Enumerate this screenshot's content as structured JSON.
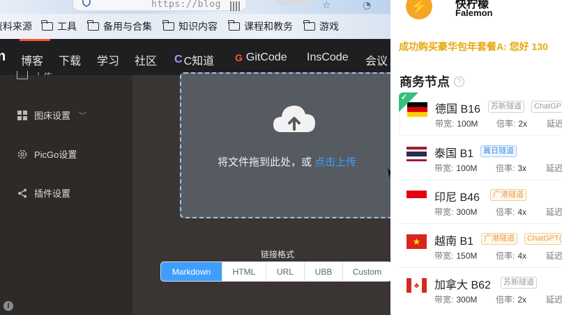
{
  "browser": {
    "url_partial": "https://blog",
    "bookmarks": [
      "资料来源",
      "工具",
      "备用与合集",
      "知识内容",
      "课程和教务",
      "游戏"
    ]
  },
  "nav": {
    "logo_fragment": "n",
    "items": [
      "博客",
      "下载",
      "学习",
      "社区",
      "C知道",
      "GitCode",
      "InsCode",
      "会议"
    ],
    "badges": {
      "cknow": "C",
      "gitcode": "G"
    },
    "accent_color": "#fc5531"
  },
  "sidebar": {
    "items": [
      {
        "label": "图床设置",
        "icon": "grid-icon"
      },
      {
        "label": "PicGo设置",
        "icon": "gear-icon"
      },
      {
        "label": "插件设置",
        "icon": "share-icon"
      }
    ],
    "partial_label": "上传"
  },
  "main": {
    "drop_text": "将文件拖到此处，或 ",
    "drop_link": "点击上传",
    "link_format_label": "链接格式",
    "formats": [
      "Markdown",
      "HTML",
      "URL",
      "UBB",
      "Custom"
    ],
    "selected_format": "Markdown",
    "accent_color": "#409eff"
  },
  "ad": {
    "logo_glyph": "⚡",
    "brand_cn": "快柠檬",
    "brand_en": "Falemon",
    "marquee": "成功购买豪华包年套餐A: 您好 130",
    "section_title": "商务节点",
    "help_glyph": "?",
    "labels": {
      "bandwidth": "带宽:",
      "rate": "倍率:",
      "latency": "延迟"
    },
    "nodes": [
      {
        "name": "德国 B16",
        "flag": "de",
        "tags": [
          {
            "text": "苏新隧道",
            "style": "gray"
          },
          {
            "text": "ChatGPT",
            "style": "gray"
          }
        ],
        "bandwidth": "100M",
        "rate": "2x",
        "selected": true
      },
      {
        "name": "泰国 B1",
        "flag": "th",
        "tags": [
          {
            "text": "冀日隧道",
            "style": "blue"
          }
        ],
        "bandwidth": "100M",
        "rate": "3x",
        "selected": false
      },
      {
        "name": "印尼 B46",
        "flag": "id",
        "tags": [
          {
            "text": "广港隧道",
            "style": "orange"
          }
        ],
        "bandwidth": "300M",
        "rate": "4x",
        "selected": false
      },
      {
        "name": "越南 B1",
        "flag": "vn",
        "tags": [
          {
            "text": "广港隧道",
            "style": "orange"
          },
          {
            "text": "ChatGPT(",
            "style": "orange"
          }
        ],
        "bandwidth": "150M",
        "rate": "4x",
        "selected": false
      },
      {
        "name": "加拿大 B62",
        "flag": "ca",
        "tags": [
          {
            "text": "苏新隧道",
            "style": "gray"
          }
        ],
        "bandwidth": "300M",
        "rate": "2x",
        "selected": false
      }
    ]
  }
}
